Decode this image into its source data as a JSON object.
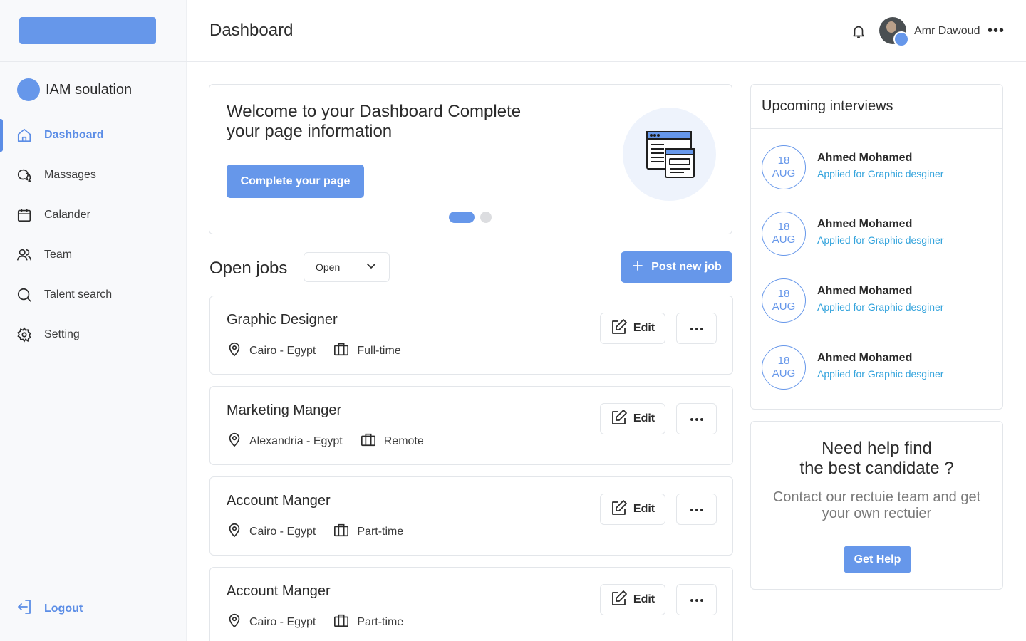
{
  "header": {
    "title": "Dashboard",
    "user_name": "Amr Dawoud",
    "more": "•••"
  },
  "sidebar": {
    "org_name": "IAM soulation",
    "items": [
      {
        "label": "Dashboard",
        "icon": "home-icon",
        "active": true
      },
      {
        "label": "Massages",
        "icon": "messages-icon",
        "active": false
      },
      {
        "label": "Calander",
        "icon": "calendar-icon",
        "active": false
      },
      {
        "label": "Team",
        "icon": "team-icon",
        "active": false
      },
      {
        "label": "Talent search",
        "icon": "search-icon",
        "active": false
      },
      {
        "label": "Setting",
        "icon": "gear-icon",
        "active": false
      }
    ],
    "logout_label": "Logout"
  },
  "welcome": {
    "title": "Welcome to your Dashboard Complete your page information",
    "button": "Complete your page"
  },
  "jobs": {
    "title": "Open jobs",
    "filter_value": "Open",
    "post_button": "Post new job",
    "edit_label": "Edit",
    "items": [
      {
        "title": "Graphic Designer",
        "location": "Cairo - Egypt",
        "type": "Full-time"
      },
      {
        "title": "Marketing Manger",
        "location": "Alexandria - Egypt",
        "type": "Remote"
      },
      {
        "title": "Account Manger",
        "location": "Cairo - Egypt",
        "type": "Part-time"
      },
      {
        "title": "Account Manger",
        "location": "Cairo - Egypt",
        "type": "Part-time"
      }
    ]
  },
  "interviews": {
    "title": "Upcoming interviews",
    "items": [
      {
        "day": "18",
        "month": "AUG",
        "name": "Ahmed Mohamed",
        "role": "Applied for Graphic desginer"
      },
      {
        "day": "18",
        "month": "AUG",
        "name": "Ahmed Mohamed",
        "role": "Applied for Graphic desginer"
      },
      {
        "day": "18",
        "month": "AUG",
        "name": "Ahmed Mohamed",
        "role": "Applied for Graphic desginer"
      },
      {
        "day": "18",
        "month": "AUG",
        "name": "Ahmed Mohamed",
        "role": "Applied for Graphic desginer"
      }
    ]
  },
  "help": {
    "title_line1": "Need help find",
    "title_line2": "the best candidate ?",
    "subtitle": "Contact our rectuie team and get your own rectuier",
    "button": "Get Help"
  },
  "colors": {
    "accent": "#6697ea",
    "link": "#33a3dc",
    "sidebar_bg": "#f8f9fb"
  }
}
